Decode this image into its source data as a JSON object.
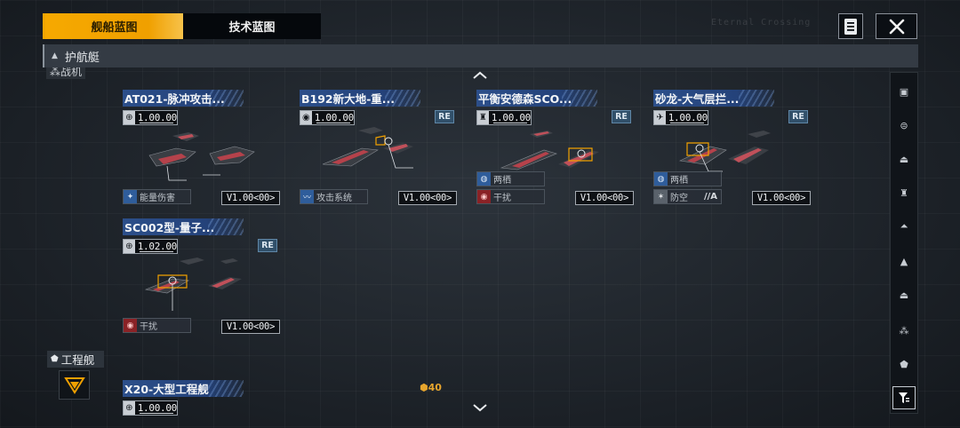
{
  "tabs": [
    {
      "label": "舰船蓝图",
      "active": true
    },
    {
      "label": "技术蓝图",
      "active": false
    }
  ],
  "header_deco_text": "Eternal Crossing",
  "section_title": "护航艇",
  "subsection_label": "战机",
  "cards": [
    {
      "title": "AT021-脉冲攻击...",
      "class_icon": "globe-icon",
      "value": "1.00.00",
      "re": "",
      "tags": [
        {
          "icon": "energy-damage-icon",
          "color": "blue",
          "label": "能量伤害",
          "extra": ""
        }
      ],
      "version": "V1.00<00>"
    },
    {
      "title": "B192新大地-重...",
      "class_icon": "heavy-icon",
      "value": "1.00.00",
      "re": "RE",
      "tags": [
        {
          "icon": "attack-system-icon",
          "color": "blue",
          "label": "攻击系统",
          "extra": ""
        }
      ],
      "version": "V1.00<00>"
    },
    {
      "title": "平衡安德森SCO...",
      "class_icon": "torpedo-icon",
      "value": "1.00.00",
      "re": "RE",
      "tags": [
        {
          "icon": "amphibious-icon",
          "color": "blue",
          "label": "两栖",
          "extra": ""
        },
        {
          "icon": "jamming-icon",
          "color": "red",
          "label": "干扰",
          "extra": ""
        }
      ],
      "version": "V1.00<00>"
    },
    {
      "title": "砂龙-大气层拦...",
      "class_icon": "interceptor-icon",
      "value": "1.00.00",
      "re": "RE",
      "tags": [
        {
          "icon": "amphibious-icon",
          "color": "blue",
          "label": "两栖",
          "extra": ""
        },
        {
          "icon": "anti-air-icon",
          "color": "gray",
          "label": "防空",
          "extra": "//A"
        }
      ],
      "version": "V1.00<00>"
    },
    {
      "title": "SC002型-量子...",
      "class_icon": "globe-icon",
      "value": "1.02.00",
      "re": "RE",
      "tags": [
        {
          "icon": "jamming-icon",
          "color": "red",
          "label": "干扰",
          "extra": ""
        }
      ],
      "version": "V1.00<00>"
    }
  ],
  "engineering": {
    "section_label": "工程舰",
    "card_title": "X20-大型工程舰",
    "value": "1.00.00"
  },
  "resource_count": "40",
  "filters": [
    "all-icon",
    "carrier-icon",
    "cruiser-icon",
    "destroyer-icon",
    "frigate-icon",
    "corvette-icon",
    "escort-icon",
    "fighter-group-icon",
    "engineering-icon",
    "filter-icon"
  ],
  "colors": {
    "accent": "#f3a500",
    "title_band": "#2c4f8a",
    "red_tag": "#8a2226",
    "blue_tag": "#2f5d9b"
  }
}
